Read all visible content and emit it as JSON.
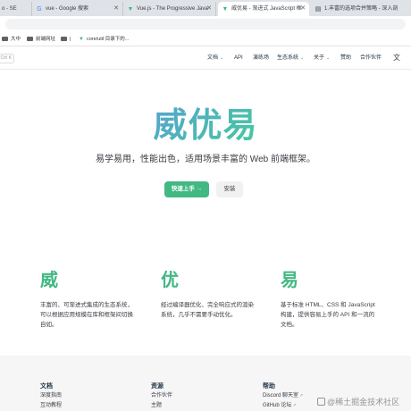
{
  "browser": {
    "tabs": [
      {
        "label": "o - SE",
        "icon": "generic-tab-icon"
      },
      {
        "label": "vue - Google 搜索",
        "icon": "google-icon"
      },
      {
        "label": "Vue.js - The Progressive Java",
        "icon": "vue-logo-icon"
      },
      {
        "label": "威优易 - 渐进式 JavaScript 框",
        "icon": "vue-logo-icon"
      },
      {
        "label": "1.丰富的选项合并策略 - 深入剖",
        "icon": "book-icon"
      }
    ],
    "bookmarks": [
      "大中",
      "前端网址",
      "|",
      "core/util 目录下的..."
    ]
  },
  "site": {
    "search_placeholder": "Ctrl K",
    "nav": [
      "文档",
      "API",
      "演练场",
      "生态系统",
      "关于",
      "赞助",
      "合作伙伴"
    ],
    "colors": {
      "brand": "#42b883",
      "gradient_start": "#647eff",
      "gradient_end": "#42d392"
    }
  },
  "hero": {
    "title": "威优易",
    "tagline": "易学易用，性能出色，适用场景丰富的 Web 前端框架。",
    "primary_button": "快速上手 →",
    "secondary_button": "安装"
  },
  "features": [
    {
      "title": "威",
      "description": "丰富的、可渐进式集成的生态系统，可以根据应用规模在库和框架间切换自如。"
    },
    {
      "title": "优",
      "description": "经过编译器优化、完全响应式的渲染系统，几乎不需要手动优化。"
    },
    {
      "title": "易",
      "description": "基于标准 HTML、CSS 和 JavaScript 构建，提供容易上手的 API 和一流的文档。"
    }
  ],
  "footer": {
    "columns": [
      {
        "heading": "文档",
        "items": [
          "深度指南",
          "互动教程"
        ]
      },
      {
        "heading": "资源",
        "items": [
          "合作伙伴",
          "主题"
        ]
      },
      {
        "heading": "帮助",
        "items": [
          "Discord 聊天室",
          "GitHub 论坛"
        ]
      }
    ],
    "watermark": "@稀土掘金技术社区"
  }
}
